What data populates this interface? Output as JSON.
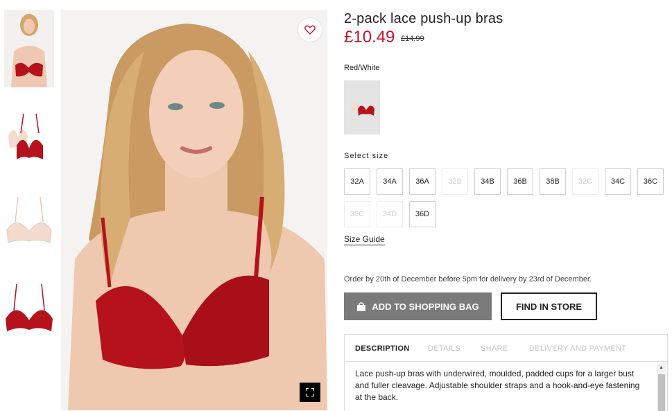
{
  "product": {
    "title": "2-pack lace push-up bras",
    "price": "£10.49",
    "old_price": "£14.99"
  },
  "colour": {
    "label": "Red/White"
  },
  "sizes": {
    "label": "Select size",
    "options": [
      {
        "size": "32A",
        "available": true
      },
      {
        "size": "34A",
        "available": true
      },
      {
        "size": "36A",
        "available": true
      },
      {
        "size": "32B",
        "available": false
      },
      {
        "size": "34B",
        "available": true
      },
      {
        "size": "36B",
        "available": true
      },
      {
        "size": "38B",
        "available": true
      },
      {
        "size": "32C",
        "available": false
      },
      {
        "size": "34C",
        "available": true
      },
      {
        "size": "36C",
        "available": true
      },
      {
        "size": "38C",
        "available": false
      },
      {
        "size": "34D",
        "available": false
      },
      {
        "size": "36D",
        "available": true
      }
    ],
    "guide_label": "Size Guide"
  },
  "delivery_note": "Order by 20th of December before 5pm for delivery by 23rd of December.",
  "actions": {
    "add_to_bag": "ADD TO SHOPPING BAG",
    "find_in_store": "FIND IN STORE"
  },
  "tabs": [
    {
      "label": "DESCRIPTION",
      "active": true
    },
    {
      "label": "DETAILS",
      "active": false
    },
    {
      "label": "SHARE",
      "active": false
    },
    {
      "label": "DELIVERY AND PAYMENT",
      "active": false
    }
  ],
  "description": "Lace push-up bras with underwired, moulded, padded cups for a larger bust and fuller cleavage. Adjustable shoulder straps and a hook-and-eye fastening at the back.",
  "icons": {
    "favourite": "heart-icon",
    "bag": "shopping-bag-icon",
    "zoom": "fullscreen-icon"
  },
  "colors": {
    "price_red": "#c8102e",
    "bra_red": "#b5121b",
    "bag_button": "#7a7a7a"
  }
}
